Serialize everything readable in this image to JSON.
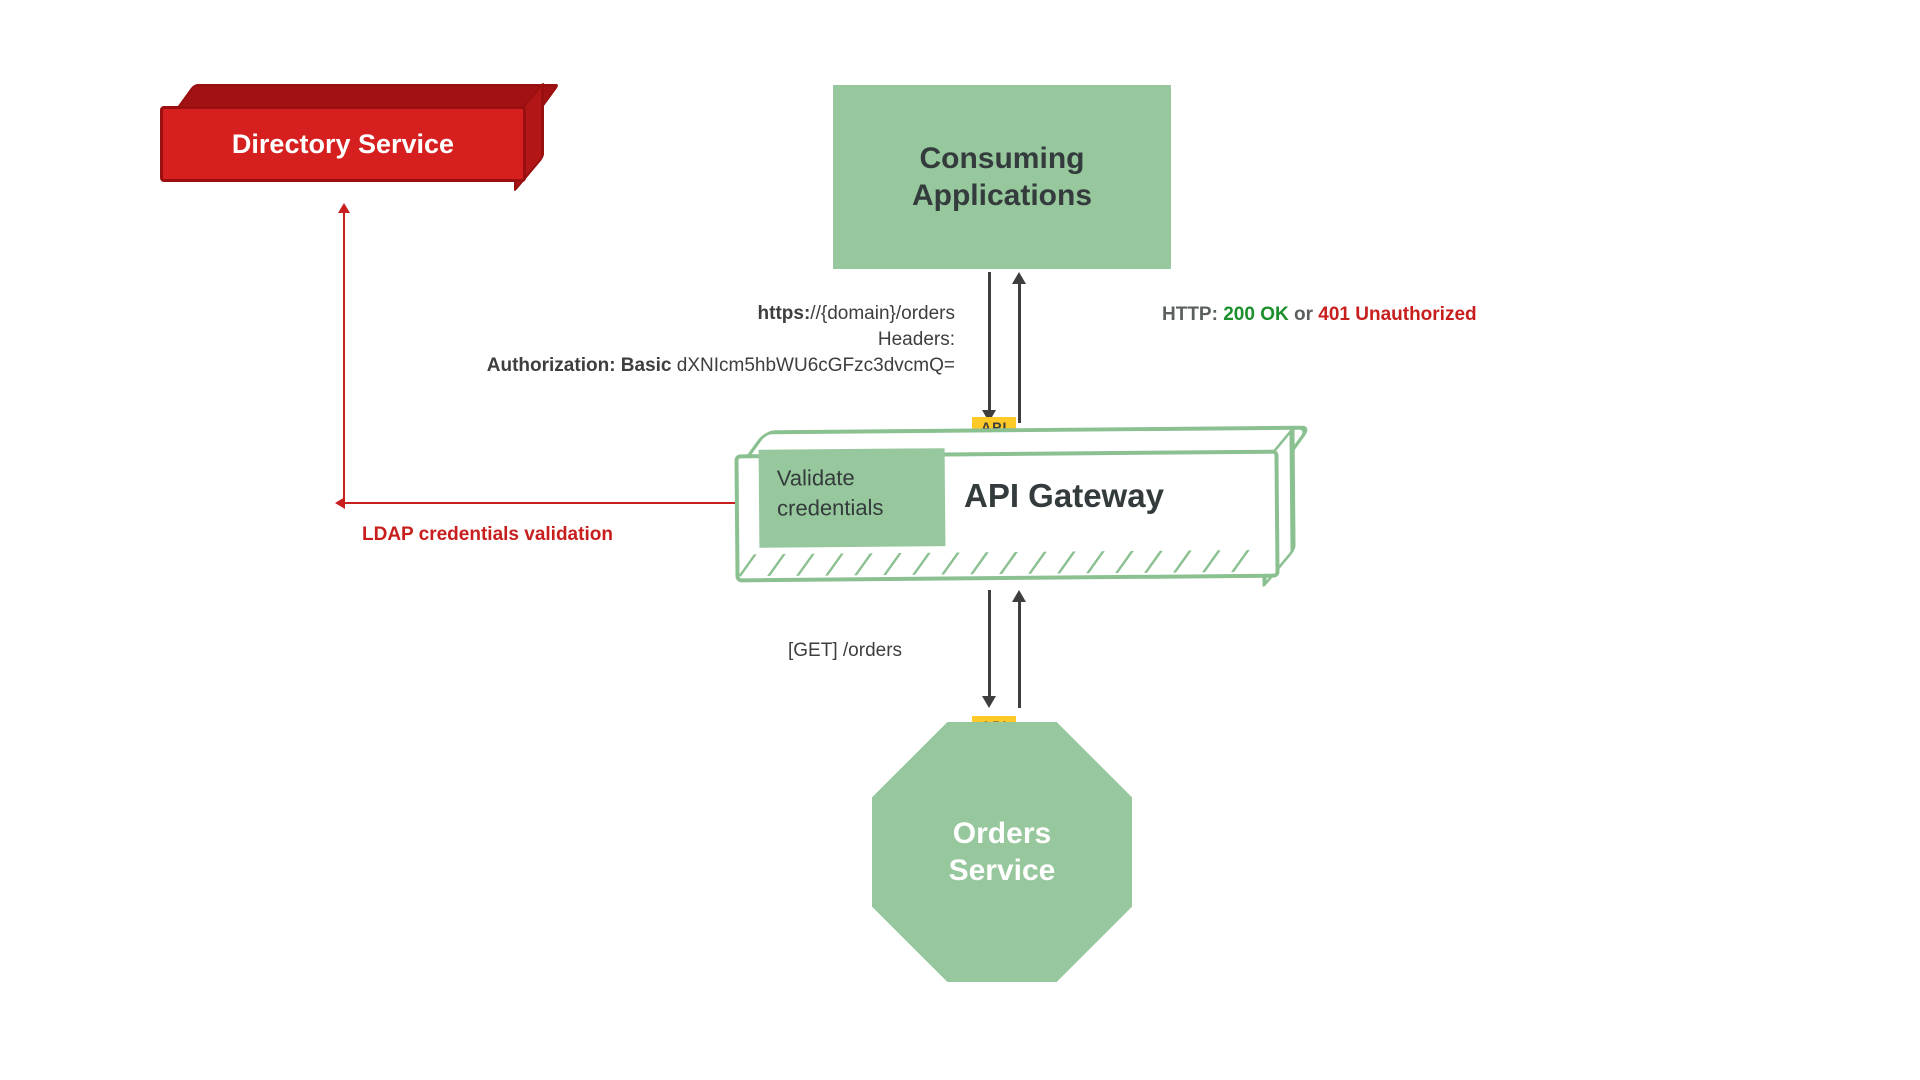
{
  "nodes": {
    "directory_service": "Directory Service",
    "consuming_apps_l1": "Consuming",
    "consuming_apps_l2": "Applications",
    "api_gateway": "API Gateway",
    "validate_l1": "Validate",
    "validate_l2": "credentials",
    "orders_l1": "Orders",
    "orders_l2": "Service"
  },
  "badges": {
    "api": "API"
  },
  "labels": {
    "ldap": "LDAP credentials validation",
    "https_prefix": "https:",
    "https_rest": "//{domain}/orders",
    "headers": "Headers:",
    "auth_prefix": "Authorization: Basic ",
    "auth_value": "dXNIcm5hbWU6cGFzc3dvcmQ=",
    "get_orders": "[GET] /orders",
    "http_prefix": "HTTP: ",
    "ok": "200 OK",
    "or": " or ",
    "unauth": "401 Unauthorized"
  }
}
